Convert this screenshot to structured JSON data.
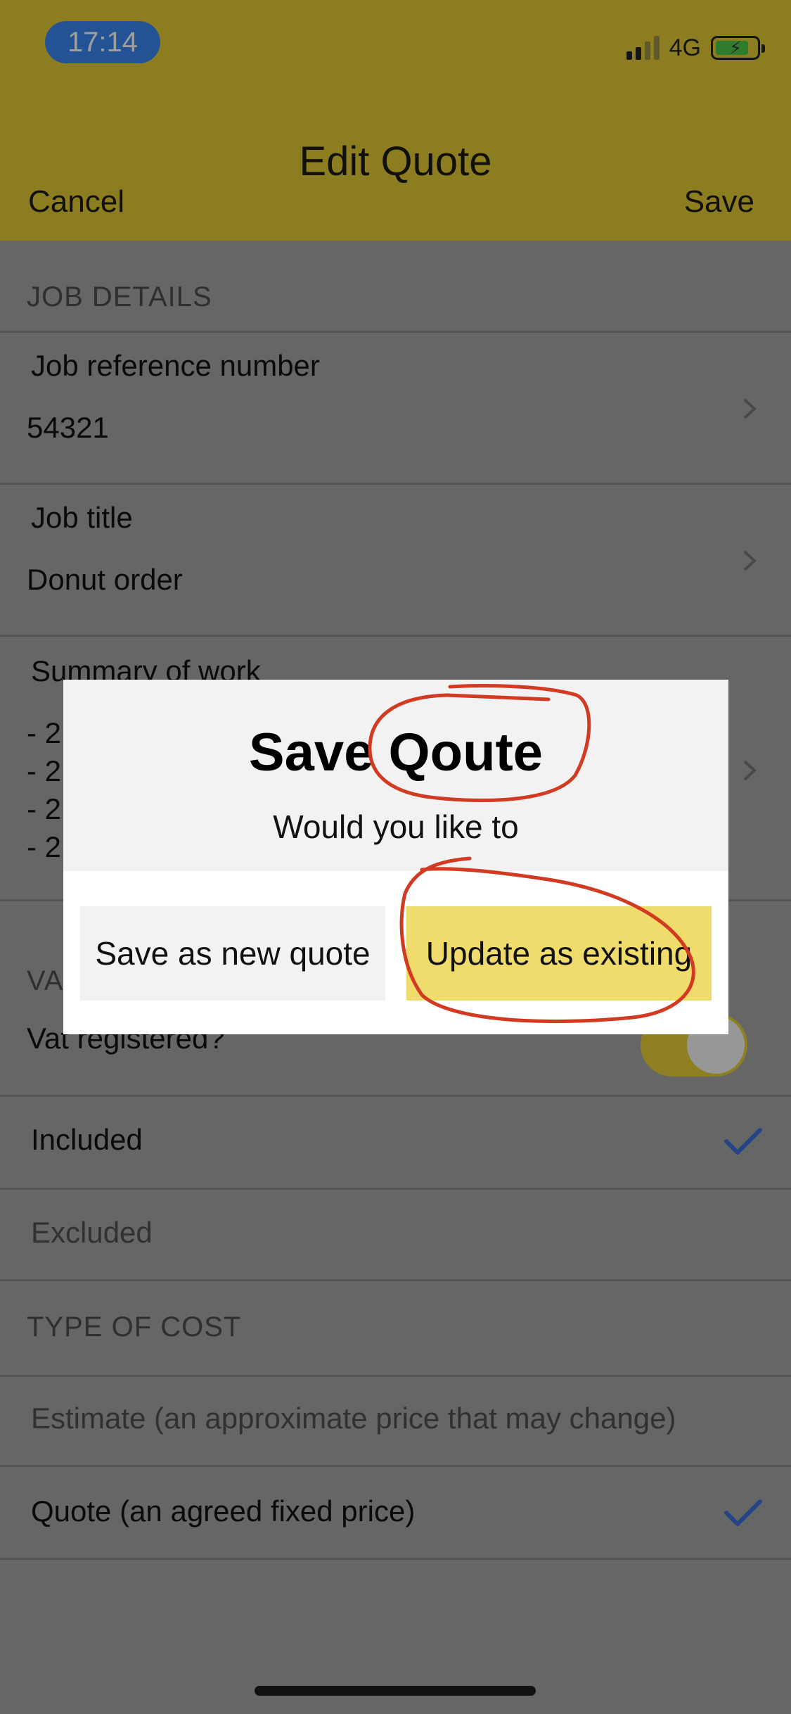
{
  "status_bar": {
    "time": "17:14",
    "network": "4G"
  },
  "nav": {
    "title": "Edit Quote",
    "cancel_label": "Cancel",
    "save_label": "Save"
  },
  "job_details": {
    "section_title": "JOB DETAILS",
    "reference": {
      "label": "Job reference number",
      "value": "54321"
    },
    "job_title": {
      "label": "Job title",
      "value": "Donut order"
    },
    "summary": {
      "label": "Summary of work",
      "lines": [
        "- 2",
        "- 2",
        "- 2",
        "- 2"
      ]
    }
  },
  "vat": {
    "section_title": "VA",
    "registered_label": "Vat registered?",
    "registered": true,
    "options": [
      {
        "label": "Included",
        "selected": true
      },
      {
        "label": "Excluded",
        "selected": false
      }
    ]
  },
  "cost_type": {
    "section_title": "TYPE OF COST",
    "options": [
      {
        "label": "Estimate (an approximate price that may change)",
        "selected": false
      },
      {
        "label": "Quote (an agreed fixed price)",
        "selected": true
      }
    ]
  },
  "dialog": {
    "title": "Save Qoute",
    "message": "Would you like to",
    "new_label": "Save as new quote",
    "update_label": "Update as existing"
  },
  "colors": {
    "header": "#e2cc35",
    "accent_button": "#f0dc6c",
    "checkmark": "#3a6fd8",
    "annotation": "#d23a22"
  }
}
